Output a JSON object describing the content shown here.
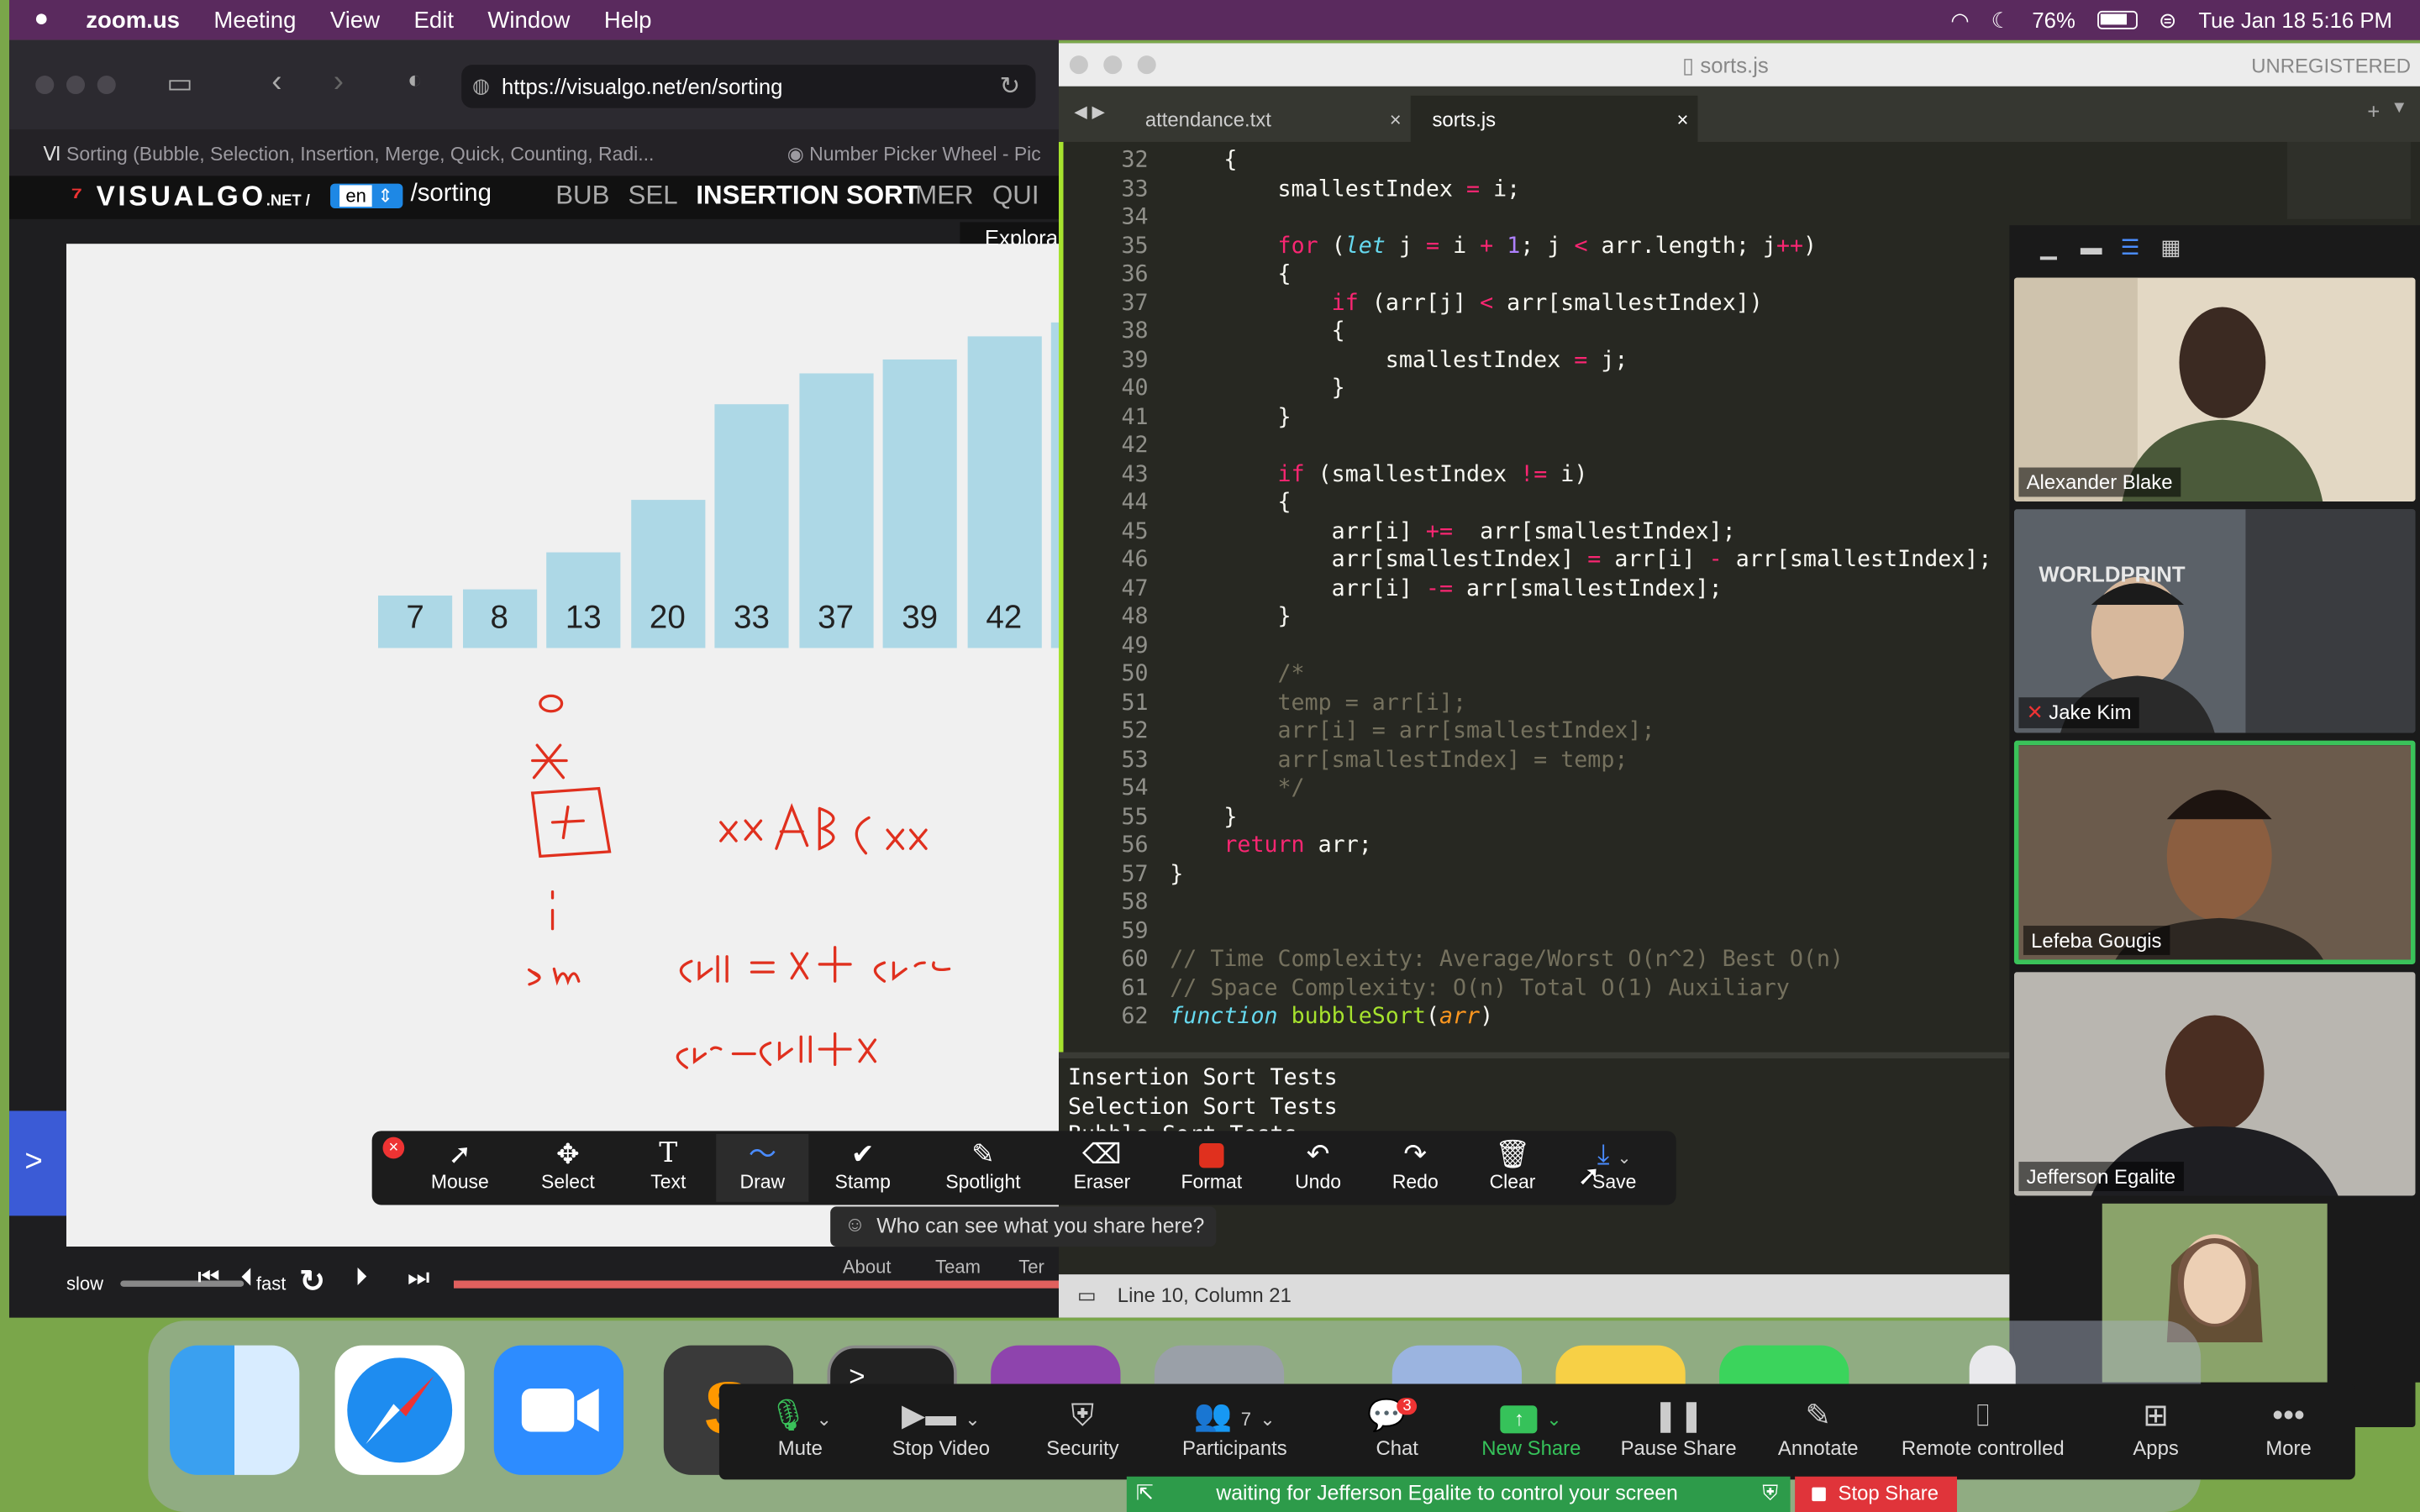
{
  "menubar": {
    "app": "zoom.us",
    "items": [
      "Meeting",
      "View",
      "Edit",
      "Window",
      "Help"
    ],
    "battery": "76%",
    "datetime": "Tue Jan 18  5:16 PM"
  },
  "browser": {
    "url": "https://visualgo.net/en/sorting",
    "tab1": "Sorting (Bubble, Selection, Insertion, Merge, Quick, Counting, Radi...",
    "tab2": "Number Picker Wheel - Pic",
    "nav": {
      "logo": "VISUALGO",
      "logo_suffix": ".NET /",
      "lang": "en",
      "path": "/sorting",
      "items": [
        "BUB",
        "SEL",
        "INSERTION SORT",
        "MER",
        "QUI"
      ],
      "explore": "Explora"
    },
    "bars": [
      {
        "label": "7",
        "value": 7
      },
      {
        "label": "8",
        "value": 8
      },
      {
        "label": "13",
        "value": 13
      },
      {
        "label": "20",
        "value": 20
      },
      {
        "label": "33",
        "value": 33
      },
      {
        "label": "37",
        "value": 37
      },
      {
        "label": "39",
        "value": 39
      },
      {
        "label": "42",
        "value": 42
      },
      {
        "label": "",
        "value": 44
      }
    ],
    "controls": {
      "slow": "slow",
      "fast": "fast",
      "about": "About",
      "team": "Team",
      "terms": "Ter"
    }
  },
  "editor": {
    "title": "sorts.js",
    "unregistered": "UNREGISTERED",
    "tabs": [
      "attendance.txt",
      "sorts.js"
    ],
    "status": "Line 10, Column 21",
    "console": [
      "Insertion Sort Tests",
      "Selection Sort Tests",
      "Bubble Sort Tests"
    ],
    "line_numbers": [
      "32",
      "33",
      "34",
      "35",
      "36",
      "37",
      "38",
      "39",
      "40",
      "41",
      "42",
      "43",
      "44",
      "45",
      "46",
      "47",
      "48",
      "49",
      "50",
      "51",
      "52",
      "53",
      "54",
      "55",
      "56",
      "57",
      "58",
      "59",
      "60",
      "61",
      "62"
    ]
  },
  "gallery": {
    "participants": [
      "Alexander Blake",
      "Jake Kim",
      "Lefeba Gougis",
      "Jefferson Egalite"
    ],
    "watermark": "WORLDPRINT"
  },
  "annotate": {
    "tools": [
      "Mouse",
      "Select",
      "Text",
      "Draw",
      "Stamp",
      "Spotlight",
      "Eraser",
      "Format",
      "Undo",
      "Redo",
      "Clear",
      "Save"
    ],
    "who": "Who can see what you share here?"
  },
  "zoom_controls": {
    "buttons": [
      "Mute",
      "Stop Video",
      "Security",
      "Participants",
      "Chat",
      "New Share",
      "Pause Share",
      "Annotate",
      "Remote controlled",
      "Apps",
      "More"
    ],
    "participants_count": "7",
    "chat_badge": "3",
    "waiting": "waiting for Jefferson Egalite to control your screen",
    "stop_share": "Stop Share"
  },
  "colors": {
    "menubar": "#5a2a5e",
    "editor_bg": "#272822",
    "bar": "#add8e6",
    "annotation": "#e0301e",
    "new_share": "#36c25a",
    "stop_share": "#e0343a"
  }
}
